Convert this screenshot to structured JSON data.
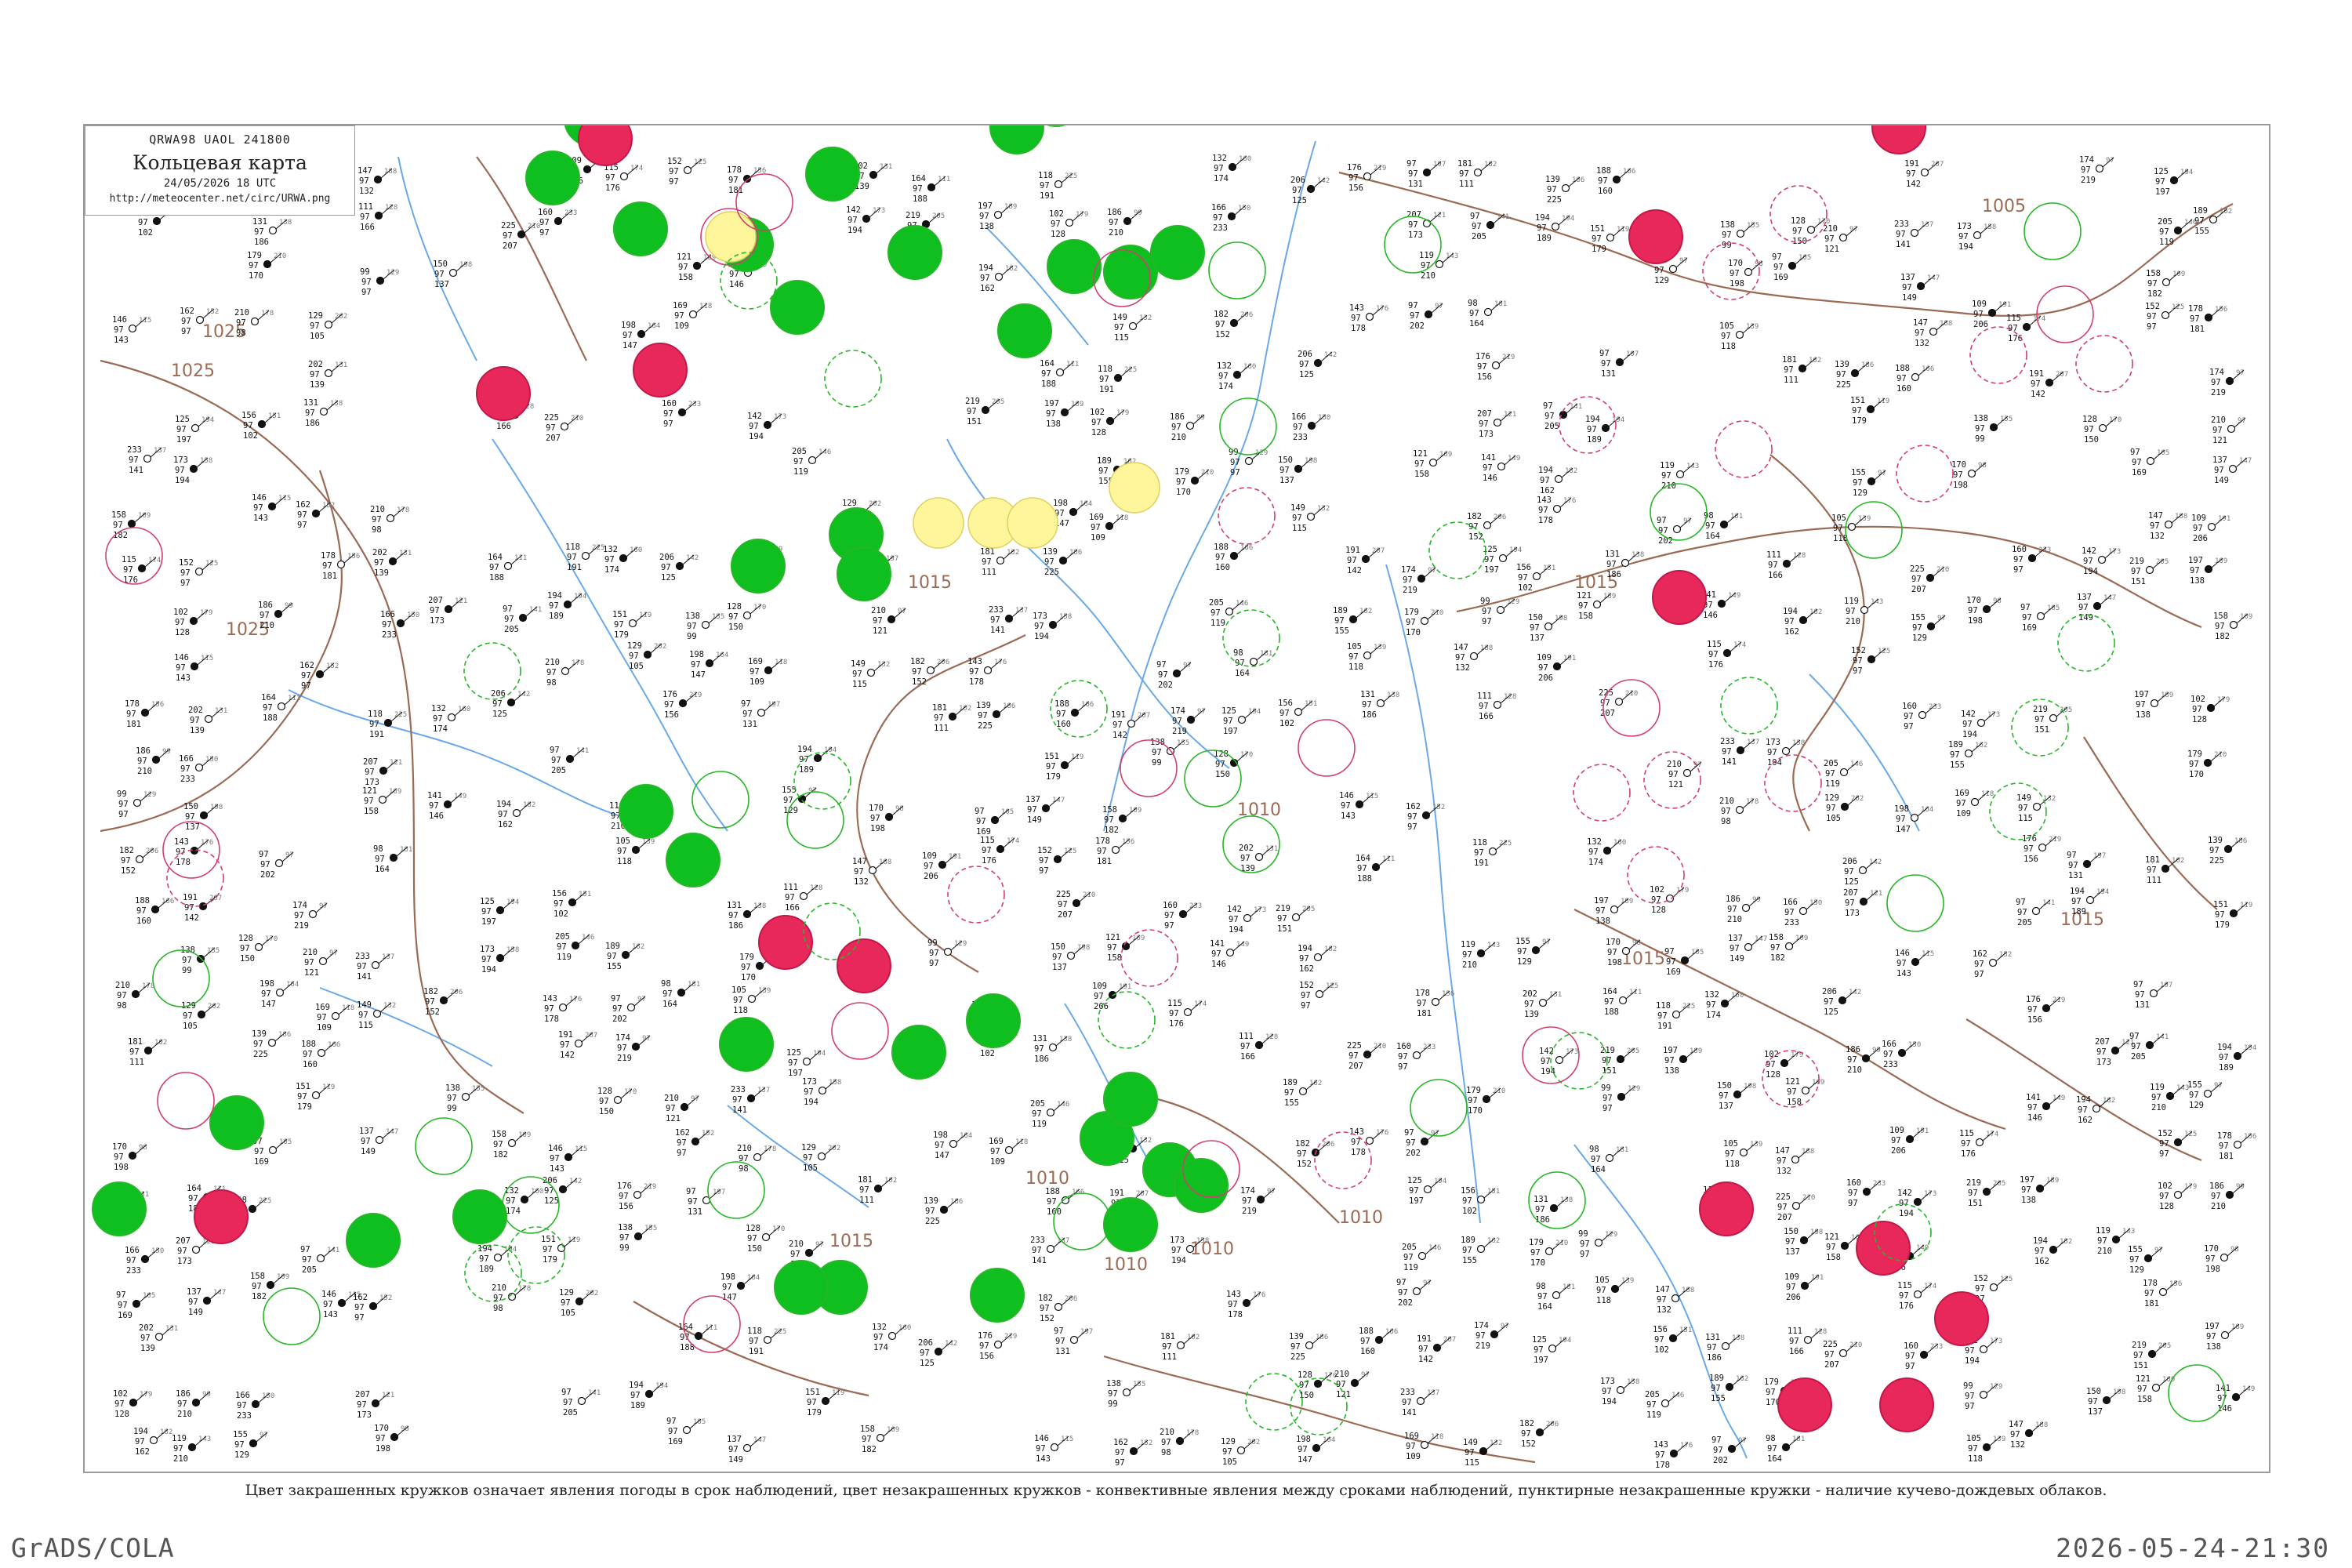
{
  "header": {
    "code_line": "QRWA98  UAOL  241800",
    "title": "Кольцевая карта",
    "datetime": "24/05/2026 18 UTC",
    "url": "http://meteocenter.net/circ/URWA.png"
  },
  "caption": "Цвет закрашенных кружков означает явления погоды в срок наблюдений, цвет незакрашенных кружков - конвективные явления между сроками наблюдений, пунктирные незакрашенные кружки - наличие кучево-дождевых облаков.",
  "footer": {
    "left": "GrADS/COLA",
    "right": "2026-05-24-21:30"
  },
  "colors": {
    "frame": "#9a9a9a",
    "isobar": "#9b6a55",
    "river": "#6aa8e8",
    "green_fill": "#0fbf1f",
    "red_fill": "#e8285a",
    "yellow_fill": "#fff59a",
    "green_ring": "#27b627",
    "red_ring": "#d0406e"
  },
  "isobar_labels": [
    "1025",
    "1025",
    "1025",
    "1015",
    "1015",
    "1015",
    "1015",
    "1015",
    "1015",
    "1010",
    "1010",
    "1010",
    "1010",
    "1010",
    "1005"
  ],
  "station_values": [
    "143",
    "97",
    "98",
    "105",
    "147",
    "109",
    "115",
    "152",
    "178",
    "202",
    "164",
    "118",
    "132",
    "206",
    "176",
    "97",
    "181",
    "139",
    "188",
    "191",
    "174",
    "125",
    "156",
    "131",
    "111",
    "225",
    "160",
    "142",
    "219",
    "197",
    "102",
    "186",
    "166",
    "207",
    "97",
    "194",
    "151",
    "138",
    "128",
    "210",
    "233",
    "173",
    "205",
    "189",
    "179",
    "99",
    "150",
    "121",
    "141",
    "194",
    "119",
    "155",
    "170",
    "97",
    "137",
    "158",
    "146",
    "162",
    "210",
    "129",
    "198",
    "169",
    "149",
    "182"
  ]
}
